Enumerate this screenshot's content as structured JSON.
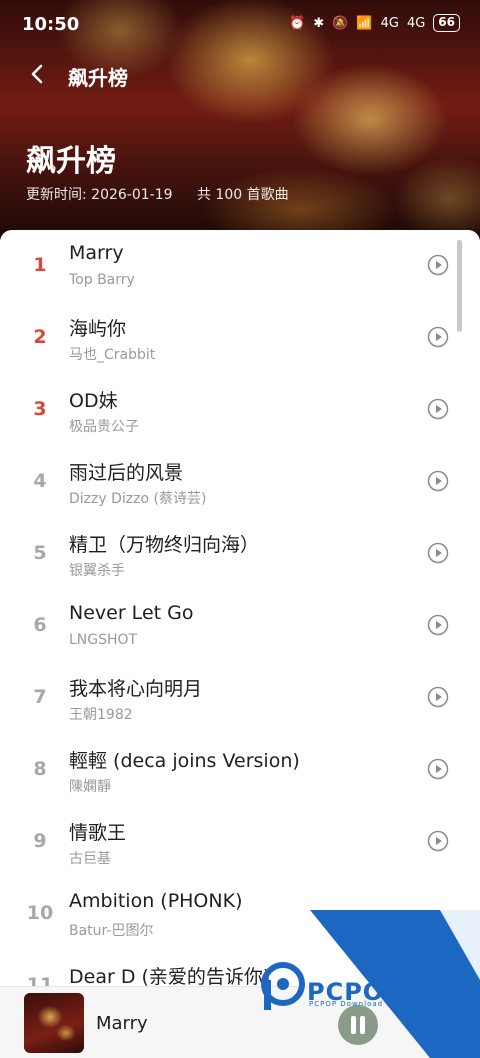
{
  "status_bar": {
    "time": "10:50",
    "battery": "66",
    "network1": "4G",
    "network2": "4G"
  },
  "nav": {
    "title": "飙升榜"
  },
  "hero": {
    "title": "飙升榜",
    "update_time": "更新时间: 2026-01-19",
    "song_count": "共 100 首歌曲"
  },
  "songs": [
    {
      "rank": "1",
      "title": "Marry",
      "artist": "Top Barry"
    },
    {
      "rank": "2",
      "title": "海屿你",
      "artist": "马也_Crabbit"
    },
    {
      "rank": "3",
      "title": "OD妹",
      "artist": "极品贵公子"
    },
    {
      "rank": "4",
      "title": "雨过后的风景",
      "artist": "Dizzy Dizzo (蔡诗芸)"
    },
    {
      "rank": "5",
      "title": "精卫（万物终归向海）",
      "artist": "银翼杀手"
    },
    {
      "rank": "6",
      "title": "Never Let Go",
      "artist": "LNGSHOT"
    },
    {
      "rank": "7",
      "title": "我本将心向明月",
      "artist": "王朝1982"
    },
    {
      "rank": "8",
      "title": "輕輕 (deca joins Version)",
      "artist": "陳嫻靜"
    },
    {
      "rank": "9",
      "title": "情歌王",
      "artist": "古巨基"
    },
    {
      "rank": "10",
      "title": "Ambition (PHONK)",
      "artist": "Batur-巴图尔"
    },
    {
      "rank": "11",
      "title": "Dear D (亲爱的告诉你)",
      "artist": ""
    }
  ],
  "player": {
    "title": "Marry"
  },
  "watermark": {
    "brand": "PCPOP下载",
    "sub": "PCPOP Download"
  },
  "colors": {
    "top_rank": "#d9473a",
    "rank": "#a8a8a8",
    "watermark_blue": "#1c67c2"
  },
  "icons": [
    "back-icon",
    "play-icon",
    "pause-icon",
    "alarm-icon",
    "bluetooth-icon",
    "mute-icon",
    "wifi-icon",
    "signal-icon",
    "battery-icon"
  ]
}
